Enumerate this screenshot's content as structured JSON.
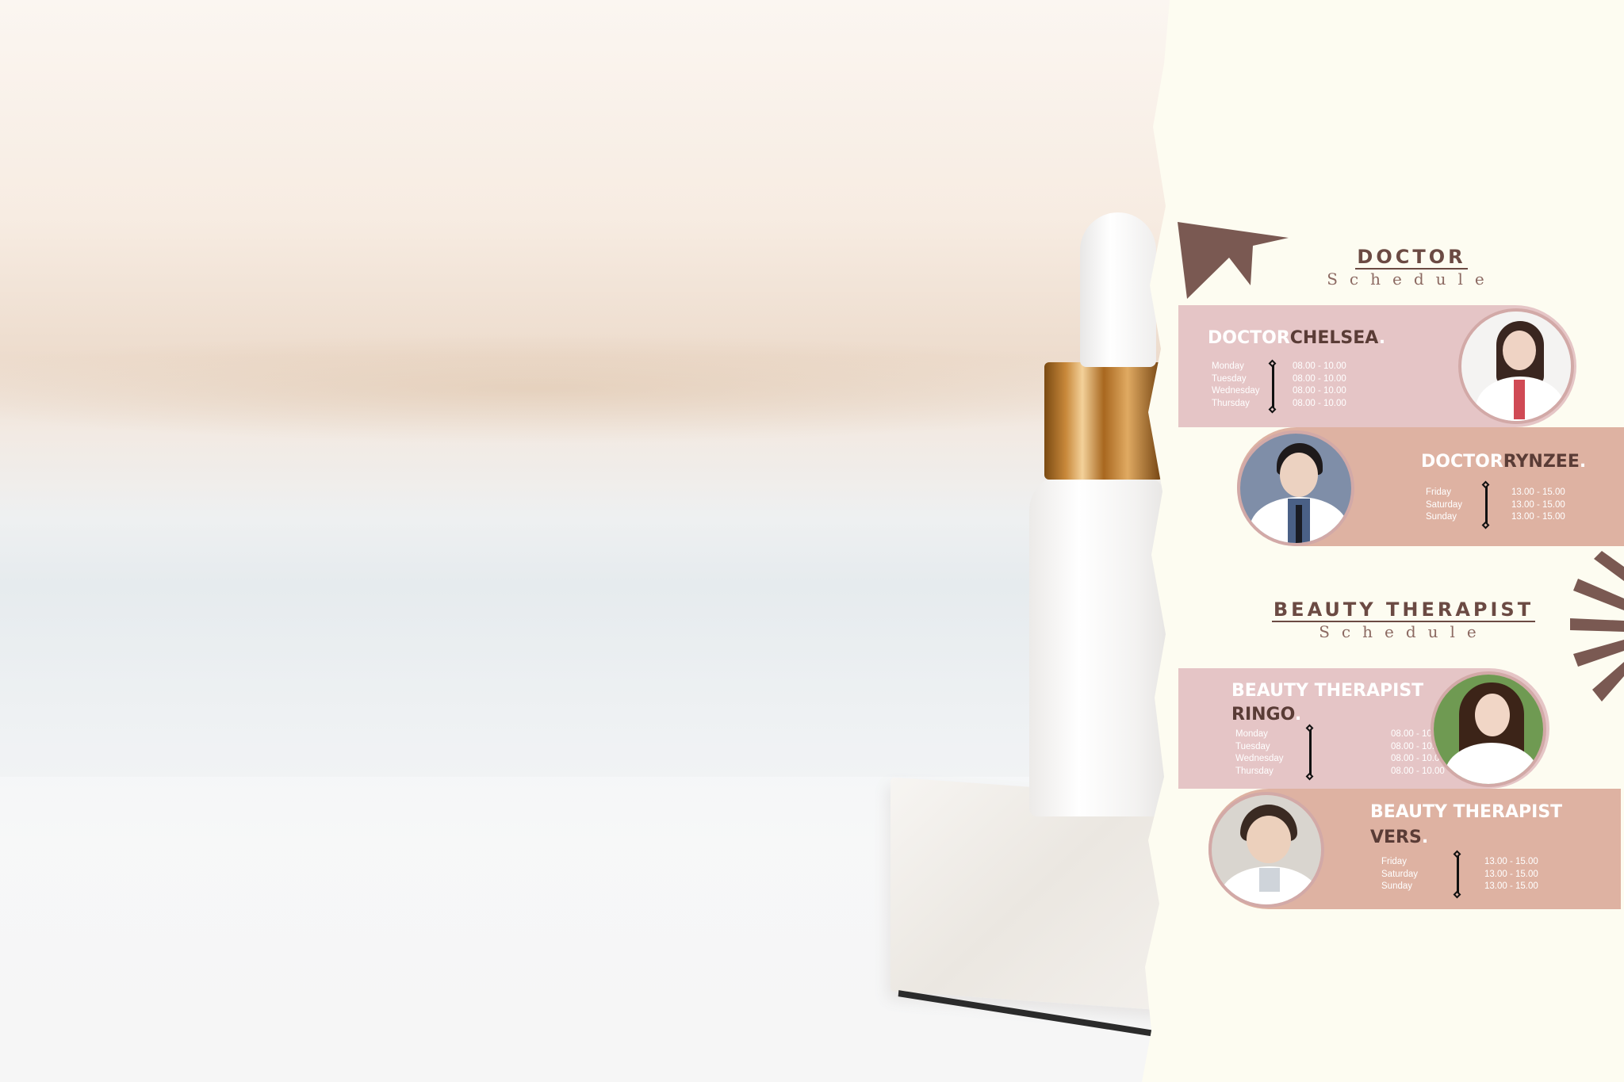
{
  "doctor_section": {
    "title": "DOCTOR",
    "subtitle": "Schedule"
  },
  "therapist_section": {
    "title": "BEAUTY THERAPIST",
    "subtitle": "Schedule"
  },
  "cards": {
    "chelsea": {
      "role": "DOCTOR",
      "name": "CHELSEA",
      "dot": ".",
      "days": [
        "Monday",
        "Tuesday",
        "Wednesday",
        "Thursday"
      ],
      "times": [
        "08.00 - 10.00",
        "08.00 - 10.00",
        "08.00 - 10.00",
        "08.00 - 10.00"
      ]
    },
    "rynzee": {
      "role": "DOCTOR",
      "name": "RYNZEE",
      "dot": ".",
      "days": [
        "Friday",
        "Saturday",
        "Sunday"
      ],
      "times": [
        "13.00 - 15.00",
        "13.00 - 15.00",
        "13.00 - 15.00"
      ]
    },
    "ringo": {
      "role": "BEAUTY THERAPIST",
      "name": "RINGO",
      "dot": ".",
      "days": [
        "Monday",
        "Tuesday",
        "Wednesday",
        "Thursday"
      ],
      "times": [
        "08.00 - 10.00",
        "08.00 - 10.00",
        "08.00 - 10.00",
        "08.00 - 10.00"
      ]
    },
    "vers": {
      "role": "BEAUTY THERAPIST",
      "name": "VERS",
      "dot": ".",
      "days": [
        "Friday",
        "Saturday",
        "Sunday"
      ],
      "times": [
        "13.00 - 15.00",
        "13.00 - 15.00",
        "13.00 - 15.00"
      ]
    }
  },
  "colors": {
    "pink_band": "#e5c5c6",
    "tan_band": "#deb2a2",
    "accent_brown": "#6b4a43",
    "paper": "#fdfcf1"
  },
  "icons": [
    "arrow-icon",
    "burst-icon",
    "schedule-line-icon"
  ]
}
